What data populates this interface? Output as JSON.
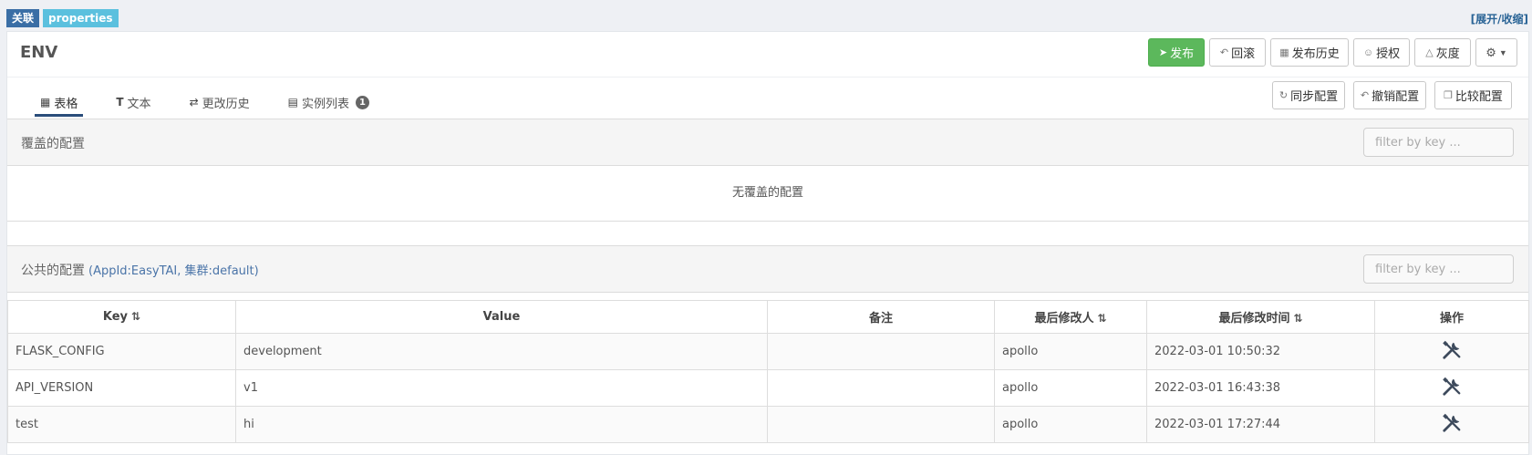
{
  "top": {
    "badge_relation": "关联",
    "badge_properties": "properties",
    "expand_toggle": "[展开/收缩]"
  },
  "env": {
    "title": "ENV",
    "buttons": {
      "publish": "发布",
      "rollback": "回滚",
      "publish_history": "发布历史",
      "authorize": "授权",
      "gray": "灰度"
    }
  },
  "tabs": {
    "table": "表格",
    "text": "文本",
    "history": "更改历史",
    "instances": "实例列表",
    "instances_count": "1"
  },
  "actions": {
    "sync": "同步配置",
    "revoke": "撤销配置",
    "compare": "比较配置"
  },
  "override_section": {
    "title": "覆盖的配置",
    "filter_placeholder": "filter by key ...",
    "empty_message": "无覆盖的配置"
  },
  "public_section": {
    "title": "公共的配置",
    "subtitle": "(AppId:EasyTAI, 集群:default)",
    "filter_placeholder": "filter by key ..."
  },
  "table": {
    "headers": {
      "key": "Key",
      "value": "Value",
      "comment": "备注",
      "modifier": "最后修改人",
      "modified_time": "最后修改时间",
      "operation": "操作"
    },
    "rows": [
      {
        "key": "FLASK_CONFIG",
        "value": "development",
        "comment": "",
        "modifier": "apollo",
        "time": "2022-03-01 10:50:32"
      },
      {
        "key": "API_VERSION",
        "value": "v1",
        "comment": "",
        "modifier": "apollo",
        "time": "2022-03-01 16:43:38"
      },
      {
        "key": "test",
        "value": "hi",
        "comment": "",
        "modifier": "apollo",
        "time": "2022-03-01 17:27:44"
      }
    ]
  },
  "icons": {
    "tool": "wrench-screwdriver-icon"
  }
}
